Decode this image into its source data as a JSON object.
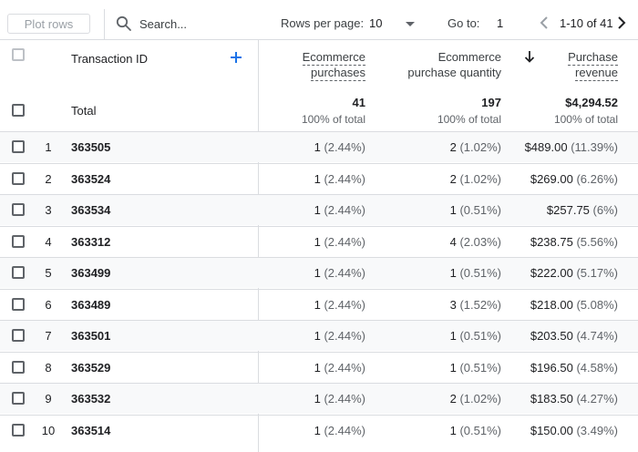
{
  "toolbar": {
    "plot_rows_label": "Plot rows",
    "search_placeholder": "Search...",
    "rows_per_page_label": "Rows per page:",
    "rows_per_page_value": "10",
    "goto_label": "Go to:",
    "goto_value": "1",
    "pagination": "1-10 of 41"
  },
  "columns": {
    "dimension": "Transaction ID",
    "m1_line1": "Ecommerce",
    "m1_line2": "purchases",
    "m2_line1": "Ecommerce",
    "m2_line2": "purchase quantity",
    "m3_line1": "Purchase",
    "m3_line2": "revenue"
  },
  "totals": {
    "label": "Total",
    "purchases": "41",
    "purchases_sub": "100% of total",
    "quantity": "197",
    "quantity_sub": "100% of total",
    "revenue": "$4,294.52",
    "revenue_sub": "100% of total"
  },
  "rows": [
    {
      "num": "1",
      "id": "363505",
      "purchases": "1",
      "purchases_pct": "(2.44%)",
      "qty": "2",
      "qty_pct": "(1.02%)",
      "rev": "$489.00",
      "rev_pct": "(11.39%)"
    },
    {
      "num": "2",
      "id": "363524",
      "purchases": "1",
      "purchases_pct": "(2.44%)",
      "qty": "2",
      "qty_pct": "(1.02%)",
      "rev": "$269.00",
      "rev_pct": "(6.26%)"
    },
    {
      "num": "3",
      "id": "363534",
      "purchases": "1",
      "purchases_pct": "(2.44%)",
      "qty": "1",
      "qty_pct": "(0.51%)",
      "rev": "$257.75",
      "rev_pct": "(6%)"
    },
    {
      "num": "4",
      "id": "363312",
      "purchases": "1",
      "purchases_pct": "(2.44%)",
      "qty": "4",
      "qty_pct": "(2.03%)",
      "rev": "$238.75",
      "rev_pct": "(5.56%)"
    },
    {
      "num": "5",
      "id": "363499",
      "purchases": "1",
      "purchases_pct": "(2.44%)",
      "qty": "1",
      "qty_pct": "(0.51%)",
      "rev": "$222.00",
      "rev_pct": "(5.17%)"
    },
    {
      "num": "6",
      "id": "363489",
      "purchases": "1",
      "purchases_pct": "(2.44%)",
      "qty": "3",
      "qty_pct": "(1.52%)",
      "rev": "$218.00",
      "rev_pct": "(5.08%)"
    },
    {
      "num": "7",
      "id": "363501",
      "purchases": "1",
      "purchases_pct": "(2.44%)",
      "qty": "1",
      "qty_pct": "(0.51%)",
      "rev": "$203.50",
      "rev_pct": "(4.74%)"
    },
    {
      "num": "8",
      "id": "363529",
      "purchases": "1",
      "purchases_pct": "(2.44%)",
      "qty": "1",
      "qty_pct": "(0.51%)",
      "rev": "$196.50",
      "rev_pct": "(4.58%)"
    },
    {
      "num": "9",
      "id": "363532",
      "purchases": "1",
      "purchases_pct": "(2.44%)",
      "qty": "2",
      "qty_pct": "(1.02%)",
      "rev": "$183.50",
      "rev_pct": "(4.27%)"
    },
    {
      "num": "10",
      "id": "363514",
      "purchases": "1",
      "purchases_pct": "(2.44%)",
      "qty": "1",
      "qty_pct": "(0.51%)",
      "rev": "$150.00",
      "rev_pct": "(3.49%)"
    }
  ],
  "icons": {
    "search": "search-icon",
    "dropdown": "caret-down-icon",
    "prev": "chevron-left-icon",
    "next": "chevron-right-icon",
    "add_dimension": "plus-icon",
    "sort": "arrow-down-icon"
  },
  "colors": {
    "accent": "#1a73e8",
    "border": "#dadce0",
    "row_shade": "#f8f9fa"
  }
}
